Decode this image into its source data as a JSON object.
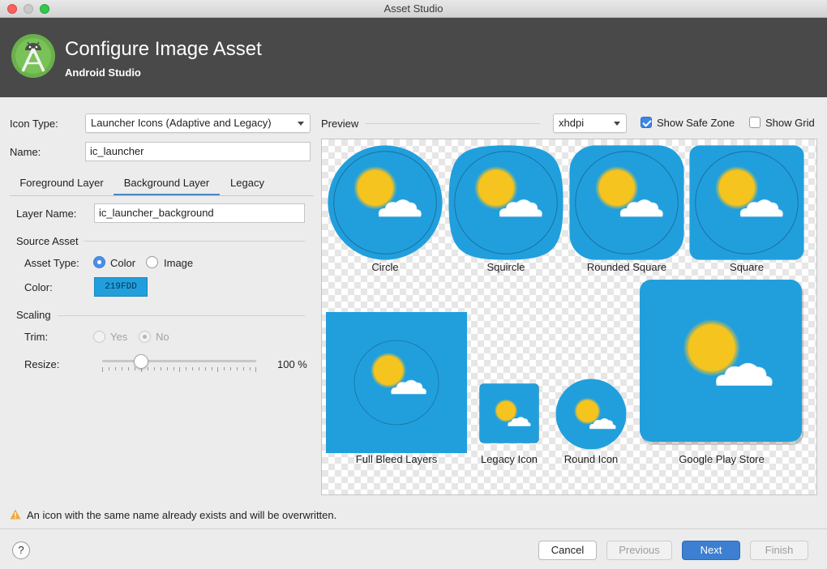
{
  "window": {
    "title": "Asset Studio"
  },
  "header": {
    "title": "Configure Image Asset",
    "subtitle": "Android Studio"
  },
  "form": {
    "icon_type_label": "Icon Type:",
    "icon_type_value": "Launcher Icons (Adaptive and Legacy)",
    "name_label": "Name:",
    "name_value": "ic_launcher"
  },
  "tabs": [
    {
      "label": "Foreground Layer",
      "active": false
    },
    {
      "label": "Background Layer",
      "active": true
    },
    {
      "label": "Legacy",
      "active": false
    }
  ],
  "layer": {
    "layer_name_label": "Layer Name:",
    "layer_name_value": "ic_launcher_background",
    "source_asset_heading": "Source Asset",
    "asset_type_label": "Asset Type:",
    "asset_type_options": [
      {
        "label": "Color",
        "selected": true
      },
      {
        "label": "Image",
        "selected": false
      }
    ],
    "color_label": "Color:",
    "color_value": "219FDD",
    "scaling_heading": "Scaling",
    "trim_label": "Trim:",
    "trim_options": [
      {
        "label": "Yes",
        "selected": false
      },
      {
        "label": "No",
        "selected": true
      }
    ],
    "resize_label": "Resize:",
    "resize_value": "100 %",
    "resize_level": 0.25
  },
  "preview": {
    "label": "Preview",
    "density": "xhdpi",
    "show_safe_zone_label": "Show Safe Zone",
    "show_safe_zone": true,
    "show_grid_label": "Show Grid",
    "show_grid": false,
    "captions": {
      "circle": "Circle",
      "squircle": "Squircle",
      "rounded_square": "Rounded Square",
      "square": "Square",
      "full_bleed": "Full Bleed Layers",
      "legacy": "Legacy Icon",
      "round": "Round Icon",
      "play_store": "Google Play Store"
    }
  },
  "warning": {
    "text": "An icon with the same name already exists and will be overwritten.",
    "icon": "warning-triangle-icon"
  },
  "buttons": {
    "help": "?",
    "cancel": "Cancel",
    "previous": "Previous",
    "next": "Next",
    "finish": "Finish"
  },
  "colors": {
    "background": "#219FDD",
    "sun": "#F5C41E",
    "cloud": "#FFFFFF",
    "header": "#494949",
    "primary_button": "#3D7FD0"
  }
}
